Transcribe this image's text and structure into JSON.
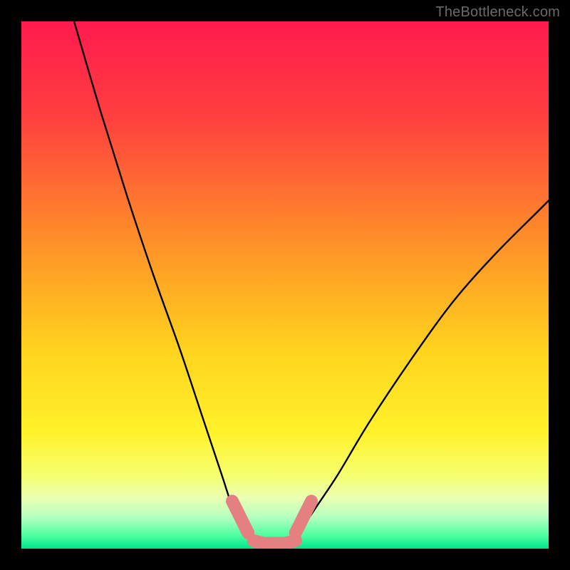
{
  "watermark": "TheBottleneck.com",
  "colors": {
    "frame": "#000000",
    "curve": "#000000",
    "marker": "#e48080",
    "watermark": "#6a6a6a"
  },
  "chart_data": {
    "type": "line",
    "title": "",
    "xlabel": "",
    "ylabel": "",
    "xlim": [
      0,
      100
    ],
    "ylim": [
      0,
      100
    ],
    "grid": false,
    "legend": false,
    "gradient_stops": [
      {
        "offset": 0,
        "color": "#ff1a4e"
      },
      {
        "offset": 0.18,
        "color": "#ff3f3f"
      },
      {
        "offset": 0.4,
        "color": "#ff8a2a"
      },
      {
        "offset": 0.62,
        "color": "#ffd21e"
      },
      {
        "offset": 0.78,
        "color": "#fff22a"
      },
      {
        "offset": 0.86,
        "color": "#f6ff6e"
      },
      {
        "offset": 0.905,
        "color": "#eaffb4"
      },
      {
        "offset": 0.94,
        "color": "#b6ffc0"
      },
      {
        "offset": 0.975,
        "color": "#4effa0"
      },
      {
        "offset": 1.0,
        "color": "#00e58c"
      }
    ],
    "series": [
      {
        "name": "left-curve",
        "x": [
          10,
          15,
          20,
          25,
          30,
          34,
          38,
          40,
          42,
          44
        ],
        "y": [
          100,
          83,
          67,
          52,
          38,
          26,
          14,
          8,
          4,
          2
        ]
      },
      {
        "name": "valley-floor",
        "x": [
          44,
          46,
          48,
          50,
          52
        ],
        "y": [
          2,
          1,
          1,
          1,
          2
        ]
      },
      {
        "name": "right-curve",
        "x": [
          52,
          56,
          60,
          66,
          74,
          82,
          90,
          98,
          100
        ],
        "y": [
          2,
          8,
          14,
          24,
          36,
          47,
          56,
          64,
          66
        ]
      }
    ],
    "markers": [
      {
        "name": "left-marker-cluster",
        "x": [
          40,
          41,
          42,
          43
        ],
        "y": [
          9,
          7,
          5,
          3
        ]
      },
      {
        "name": "right-marker-cluster",
        "x": [
          52,
          53,
          54,
          55
        ],
        "y": [
          3,
          5,
          7,
          9
        ]
      },
      {
        "name": "floor-marker-cluster",
        "x": [
          44,
          46,
          48,
          50,
          52
        ],
        "y": [
          1.5,
          1,
          1,
          1,
          1.5
        ]
      }
    ]
  }
}
